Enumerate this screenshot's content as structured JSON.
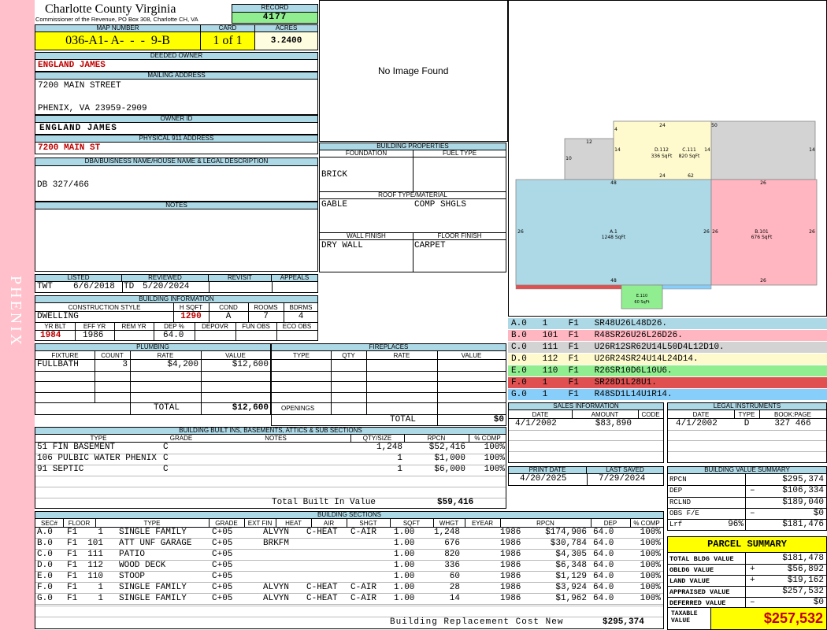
{
  "header": {
    "county": "Charlotte County Virginia",
    "commissioner": "Commissioner of the Revenue, PO Box 308, Charlotte CH, VA",
    "record_label": "RECORD",
    "record": "4177",
    "map_label": "MAP NUMBER",
    "map_number": "036-A1- A-  -  -  9-B",
    "card_label": "CARD",
    "card": "1 of 1",
    "acres_label": "ACRES",
    "acres": "3.2400"
  },
  "owner": {
    "deeded_label": "DEEDED OWNER",
    "deeded": "ENGLAND JAMES",
    "mailing_label": "MAILING ADDRESS",
    "street": "7200 MAIN STREET",
    "city": "PHENIX, VA 23959-2909",
    "ownerid_label": "OWNER ID",
    "ownerid": "ENGLAND JAMES",
    "phys_label": "PHYSICAL 911 ADDRESS",
    "physical": "7200 MAIN ST",
    "dba_label": "DBA/BUISNESS NAME/HOUSE NAME & LEGAL DESCRIPTION",
    "legal": "DB 327/466",
    "notes_label": "NOTES"
  },
  "side_text": "PHENIX",
  "no_image": "No Image Found",
  "building_props": {
    "title": "BUILDING PROPERTIES",
    "foundation_label": "FOUNDATION",
    "fuel_label": "FUEL TYPE",
    "foundation": "BRICK",
    "fuel": "",
    "roof_label": "ROOF TYPE/MATERIAL",
    "roof_type": "GABLE",
    "roof_mat": "COMP SHGLS",
    "wall_label": "WALL FINISH",
    "floor_label": "FLOOR FINISH",
    "wall": "DRY WALL",
    "floor": "CARPET"
  },
  "listing": {
    "listed_label": "LISTED",
    "reviewed_label": "REVIEWED",
    "revisit_label": "REVISIT",
    "appeals_label": "APPEALS",
    "lister": "TWT",
    "listed": "6/6/2018",
    "reviewer": "TD",
    "reviewed": "5/20/2024"
  },
  "building_info": {
    "title": "BUILDING INFORMATION",
    "construction_label": "CONSTRUCTION STYLE",
    "hsqft_label": "H SQFT",
    "cond_label": "COND",
    "rooms_label": "ROOMS",
    "bdrms_label": "BDRMS",
    "construction": "DWELLING",
    "hsqft": "1290",
    "cond": "A",
    "rooms": "7",
    "bdrms": "4",
    "yrblt_label": "YR BLT",
    "effyr_label": "EFF YR",
    "remyr_label": "REM YR",
    "dep_label": "DEP %",
    "depovr_label": "DEPOVR",
    "funobs_label": "FUN OBS",
    "ecoobs_label": "ECO OBS",
    "yrblt": "1984",
    "effyr": "1986",
    "dep": "64.0"
  },
  "plumbing": {
    "title": "PLUMBING",
    "headers": [
      "FIXTURE",
      "COUNT",
      "RATE",
      "VALUE"
    ],
    "rows": [
      {
        "fixture": "FULLBATH",
        "count": "3",
        "rate": "$4,200",
        "value": "$12,600"
      }
    ],
    "total_label": "TOTAL",
    "total": "$12,600"
  },
  "fireplaces": {
    "title": "FIREPLACES",
    "headers": [
      "TYPE",
      "QTY",
      "RATE",
      "VALUE"
    ],
    "openings_label": "OPENINGS",
    "total_label": "TOTAL",
    "total": "$0"
  },
  "builtins": {
    "title": "BUILDING BUILT INS, BASEMENTS, ATTICS & SUB SECTIONS",
    "headers": [
      "TYPE",
      "GRADE",
      "NOTES",
      "QTY/SIZE",
      "RPCN",
      "% COMP"
    ],
    "rows": [
      {
        "type": "51 FIN BASEMENT",
        "grade": "C",
        "qty": "1,248",
        "rpcn": "$52,416",
        "comp": "100%"
      },
      {
        "type": "106 PULBIC WATER PHENIX",
        "grade": "C",
        "qty": "1",
        "rpcn": "$1,000",
        "comp": "100%"
      },
      {
        "type": "91 SEPTIC",
        "grade": "C",
        "qty": "1",
        "rpcn": "$6,000",
        "comp": "100%"
      }
    ],
    "total_label": "Total Built In Value",
    "total": "$59,416"
  },
  "sections": {
    "title": "BUILDING SECTIONS",
    "headers": [
      "SEC#",
      "FLOOR",
      "TYPE",
      "GRADE",
      "EXT FIN",
      "HEAT",
      "AIR",
      "SHGT",
      "SQFT",
      "WHGT",
      "EYEAR",
      "RPCN",
      "DEP",
      "% COMP"
    ],
    "rows": [
      {
        "sec": "A.0",
        "floor": "F1",
        "code": "1",
        "type": "SINGLE FAMILY",
        "grade": "C+05",
        "ext": "ALVYN",
        "heat": "C-HEAT",
        "air": "C-AIR",
        "shgt": "1.00",
        "sqft": "1,248",
        "eyear": "1986",
        "rpcn": "$174,906",
        "dep": "64.0",
        "comp": "100%"
      },
      {
        "sec": "B.0",
        "floor": "F1",
        "code": "101",
        "type": "ATT UNF GARAGE",
        "grade": "C+05",
        "ext": "BRKFM",
        "heat": "",
        "air": "",
        "shgt": "1.00",
        "sqft": "676",
        "eyear": "1986",
        "rpcn": "$30,784",
        "dep": "64.0",
        "comp": "100%"
      },
      {
        "sec": "C.0",
        "floor": "F1",
        "code": "111",
        "type": "PATIO",
        "grade": "C+05",
        "ext": "",
        "heat": "",
        "air": "",
        "shgt": "1.00",
        "sqft": "820",
        "eyear": "1986",
        "rpcn": "$4,305",
        "dep": "64.0",
        "comp": "100%"
      },
      {
        "sec": "D.0",
        "floor": "F1",
        "code": "112",
        "type": "WOOD DECK",
        "grade": "C+05",
        "ext": "",
        "heat": "",
        "air": "",
        "shgt": "1.00",
        "sqft": "336",
        "eyear": "1986",
        "rpcn": "$6,348",
        "dep": "64.0",
        "comp": "100%"
      },
      {
        "sec": "E.0",
        "floor": "F1",
        "code": "110",
        "type": "STOOP",
        "grade": "C+05",
        "ext": "",
        "heat": "",
        "air": "",
        "shgt": "1.00",
        "sqft": "60",
        "eyear": "1986",
        "rpcn": "$1,129",
        "dep": "64.0",
        "comp": "100%"
      },
      {
        "sec": "F.0",
        "floor": "F1",
        "code": "1",
        "type": "SINGLE FAMILY",
        "grade": "C+05",
        "ext": "ALVYN",
        "heat": "C-HEAT",
        "air": "C-AIR",
        "shgt": "1.00",
        "sqft": "28",
        "eyear": "1986",
        "rpcn": "$3,924",
        "dep": "64.0",
        "comp": "100%"
      },
      {
        "sec": "G.0",
        "floor": "F1",
        "code": "1",
        "type": "SINGLE FAMILY",
        "grade": "C+05",
        "ext": "ALVYN",
        "heat": "C-HEAT",
        "air": "C-AIR",
        "shgt": "1.00",
        "sqft": "14",
        "eyear": "1986",
        "rpcn": "$1,962",
        "dep": "64.0",
        "comp": "100%"
      }
    ],
    "total_label": "Building Replacement Cost New",
    "total": "$295,374"
  },
  "sketch": {
    "a_label": "A.1",
    "a_sqft": "1248 SqFt",
    "b_label": "B.101",
    "b_sqft": "676 SqFt",
    "c_label": "C.111",
    "c_sqft": "820 SqFt",
    "d_label": "D.112",
    "d_sqft": "336 SqFt",
    "e_label": "E.110",
    "e_sqft": "60 SqFt",
    "dims": {
      "d48a": "48",
      "d48b": "48",
      "d26l": "26",
      "d26r": "26",
      "d26b1": "26",
      "d26b2": "26",
      "d26t": "26",
      "d26bb": "26",
      "d24a": "24",
      "d24b": "24",
      "d62": "62",
      "d50": "50",
      "d14a": "14",
      "d14b": "14",
      "d14c": "14",
      "d12": "12",
      "d10": "10",
      "d4": "4"
    }
  },
  "legend": [
    {
      "text": "A.0   1    F1   SR48U26L48D26.",
      "color": "#add8e6"
    },
    {
      "text": "B.0   101  F1   R48SR26U26L26D26.",
      "color": "#ffb6c1"
    },
    {
      "text": "C.0   111  F1   U26R12SR62U14L50D4L12D10.",
      "color": "#d3d3d3"
    },
    {
      "text": "D.0   112  F1   U26R24SR24U14L24D14.",
      "color": "#fffacd"
    },
    {
      "text": "E.0   110  F1   R26SR10D6L10U6.",
      "color": "#90ee90"
    },
    {
      "text": "F.0   1    F1   SR28D1L28U1.",
      "color": "#e05050"
    },
    {
      "text": "G.0   1    F1   R48SD1L14U1R14.",
      "color": "#87cefa"
    }
  ],
  "sales": {
    "title": "SALES INFORMATION",
    "headers": [
      "DATE",
      "AMOUNT",
      "CODE"
    ],
    "date": "4/1/2002",
    "amount": "$83,890",
    "code": ""
  },
  "legal_instruments": {
    "title": "LEGAL INSTRUMENTS",
    "headers": [
      "DATE",
      "TYPE",
      "BOOK:PAGE"
    ],
    "date": "4/1/2002",
    "type": "D",
    "book": "327 466"
  },
  "dates": {
    "print_label": "PRINT DATE",
    "saved_label": "LAST SAVED",
    "print": "4/20/2025",
    "saved": "7/29/2024"
  },
  "value_summary": {
    "title": "BUILDING VALUE SUMMARY",
    "rpcn_label": "RPCN",
    "rpcn": "$295,374",
    "dep_label": "DEP",
    "dep_sign": "–",
    "dep": "$106,334",
    "rclnd_label": "RCLND",
    "rclnd": "$189,040",
    "obs_label": "OBS F/E",
    "obs_sign": "–",
    "obs": "$0",
    "lrf_label": "Lrf",
    "lrf_pct": "96%",
    "lrf": "$181,476"
  },
  "parcel": {
    "title": "PARCEL SUMMARY",
    "tbv_label": "TOTAL BLDG VALUE",
    "tbv": "$181,478",
    "obldg_label": "OBLDG VALUE",
    "obldg_sign": "+",
    "obldg": "$56,892",
    "land_label": "LAND VALUE",
    "land_sign": "+",
    "land": "$19,162",
    "appraised_label": "APPRAISED VALUE",
    "appraised": "$257,532",
    "deferred_label": "DEFERRED VALUE",
    "deferred_sign": "–",
    "deferred": "$0",
    "taxable_label": "TAXABLE VALUE",
    "taxable": "$257,532"
  }
}
